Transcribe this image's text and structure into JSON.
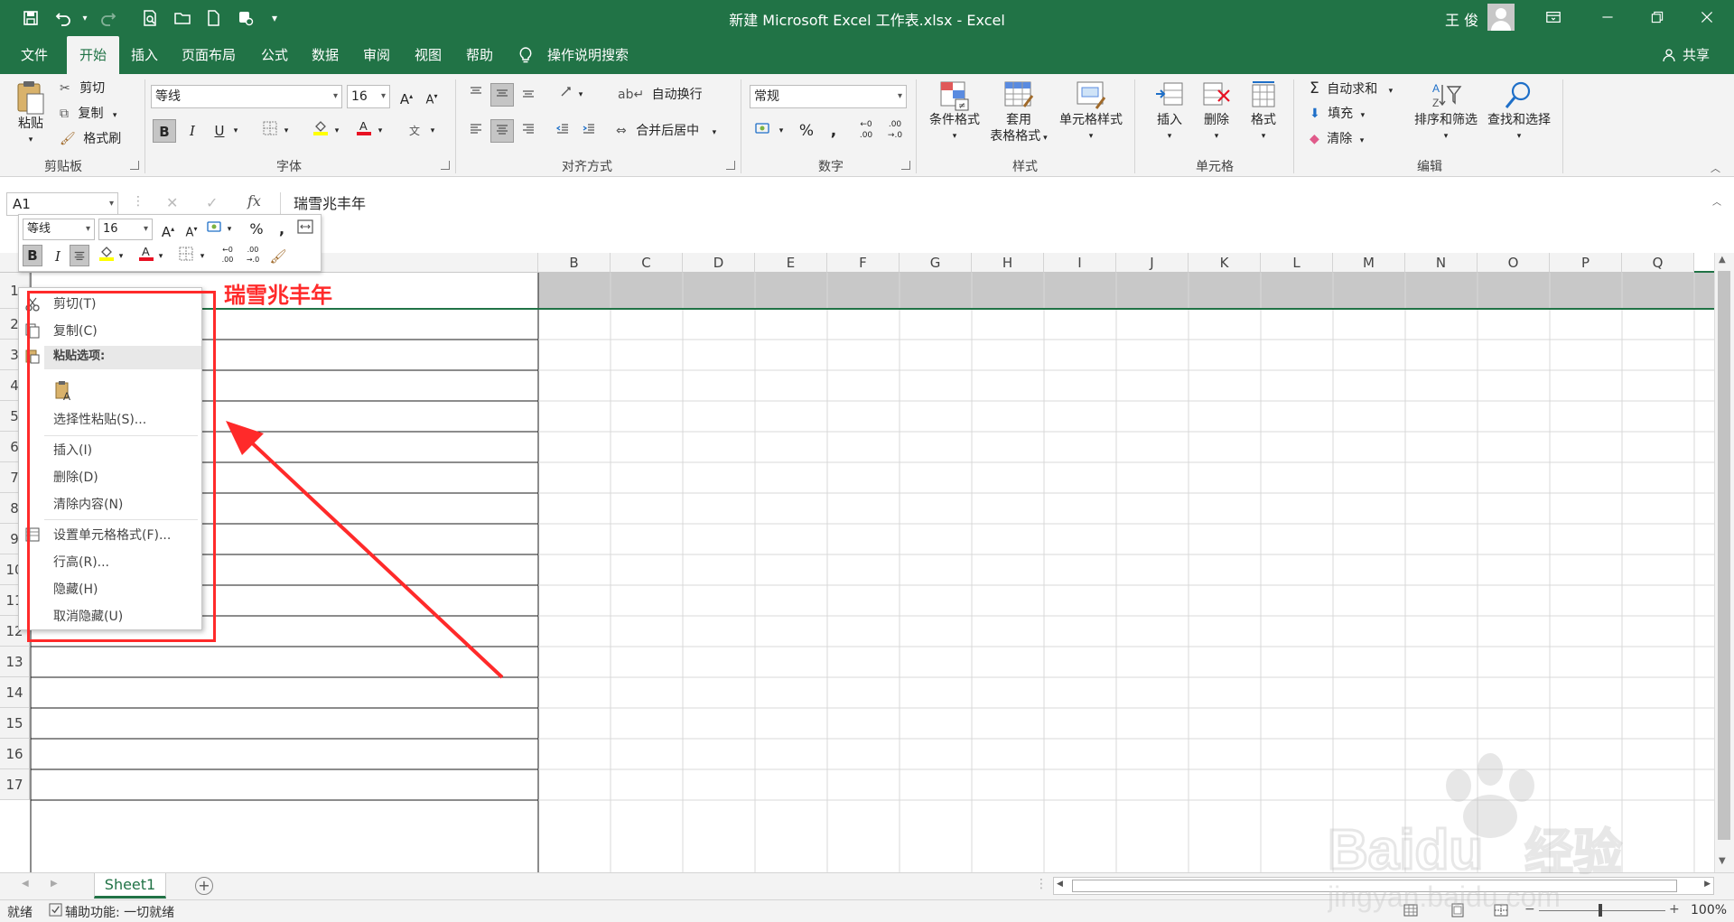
{
  "window": {
    "title": "新建 Microsoft Excel 工作表.xlsx  -  Excel",
    "user": "王 俊"
  },
  "ribbon_tabs": [
    "文件",
    "开始",
    "插入",
    "页面布局",
    "公式",
    "数据",
    "审阅",
    "视图",
    "帮助"
  ],
  "tell_me": "操作说明搜索",
  "share": "共享",
  "clipboard": {
    "paste": "粘贴",
    "cut": "剪切",
    "copy": "复制",
    "format_painter": "格式刷",
    "group": "剪贴板"
  },
  "font": {
    "name": "等线",
    "size": "16",
    "group": "字体",
    "bold": "B",
    "italic": "I",
    "underline": "U"
  },
  "alignment": {
    "wrap": "自动换行",
    "merge": "合并后居中",
    "group": "对齐方式"
  },
  "number": {
    "format": "常规",
    "group": "数字"
  },
  "styles": {
    "conditional": "条件格式",
    "table_format_1": "套用",
    "table_format_2": "表格格式",
    "cell_styles": "单元格样式",
    "group": "样式"
  },
  "cells": {
    "insert": "插入",
    "delete": "删除",
    "format": "格式",
    "group": "单元格"
  },
  "editing": {
    "autosum": "自动求和",
    "fill": "填充",
    "clear": "清除",
    "sort_filter": "排序和筛选",
    "find_select": "查找和选择",
    "group": "编辑"
  },
  "formula_bar": {
    "name_box": "A1",
    "fx": "fx",
    "content": "瑞雪兆丰年"
  },
  "mini_toolbar": {
    "font": "等线",
    "size": "16"
  },
  "columns": [
    "B",
    "C",
    "D",
    "E",
    "F",
    "G",
    "H",
    "I",
    "J",
    "K",
    "L",
    "M",
    "N",
    "O",
    "P",
    "Q"
  ],
  "rows": [
    "1",
    "2",
    "3",
    "4",
    "5",
    "6",
    "7",
    "8",
    "9",
    "10",
    "11",
    "12",
    "13",
    "14",
    "15",
    "16",
    "17"
  ],
  "cell_a1": "瑞雪兆丰年",
  "context_menu": {
    "cut": "剪切(T)",
    "copy": "复制(C)",
    "paste_options": "粘贴选项:",
    "paste_special": "选择性粘贴(S)...",
    "insert": "插入(I)",
    "delete": "删除(D)",
    "clear": "清除内容(N)",
    "format_cells": "设置单元格格式(F)...",
    "row_height": "行高(R)...",
    "hide": "隐藏(H)",
    "unhide": "取消隐藏(U)"
  },
  "sheet": {
    "tab": "Sheet1"
  },
  "status": {
    "ready": "就绪",
    "accessibility": "辅助功能: 一切就绪",
    "zoom": "100%"
  },
  "watermark": {
    "brand": "Baidu",
    "brand_cn": "经验",
    "url": "jingyan.baidu.com"
  },
  "colors": {
    "excel_green": "#217346",
    "annotation_red": "#ff2a2a",
    "ribbon_bg": "#f3f3f3"
  }
}
